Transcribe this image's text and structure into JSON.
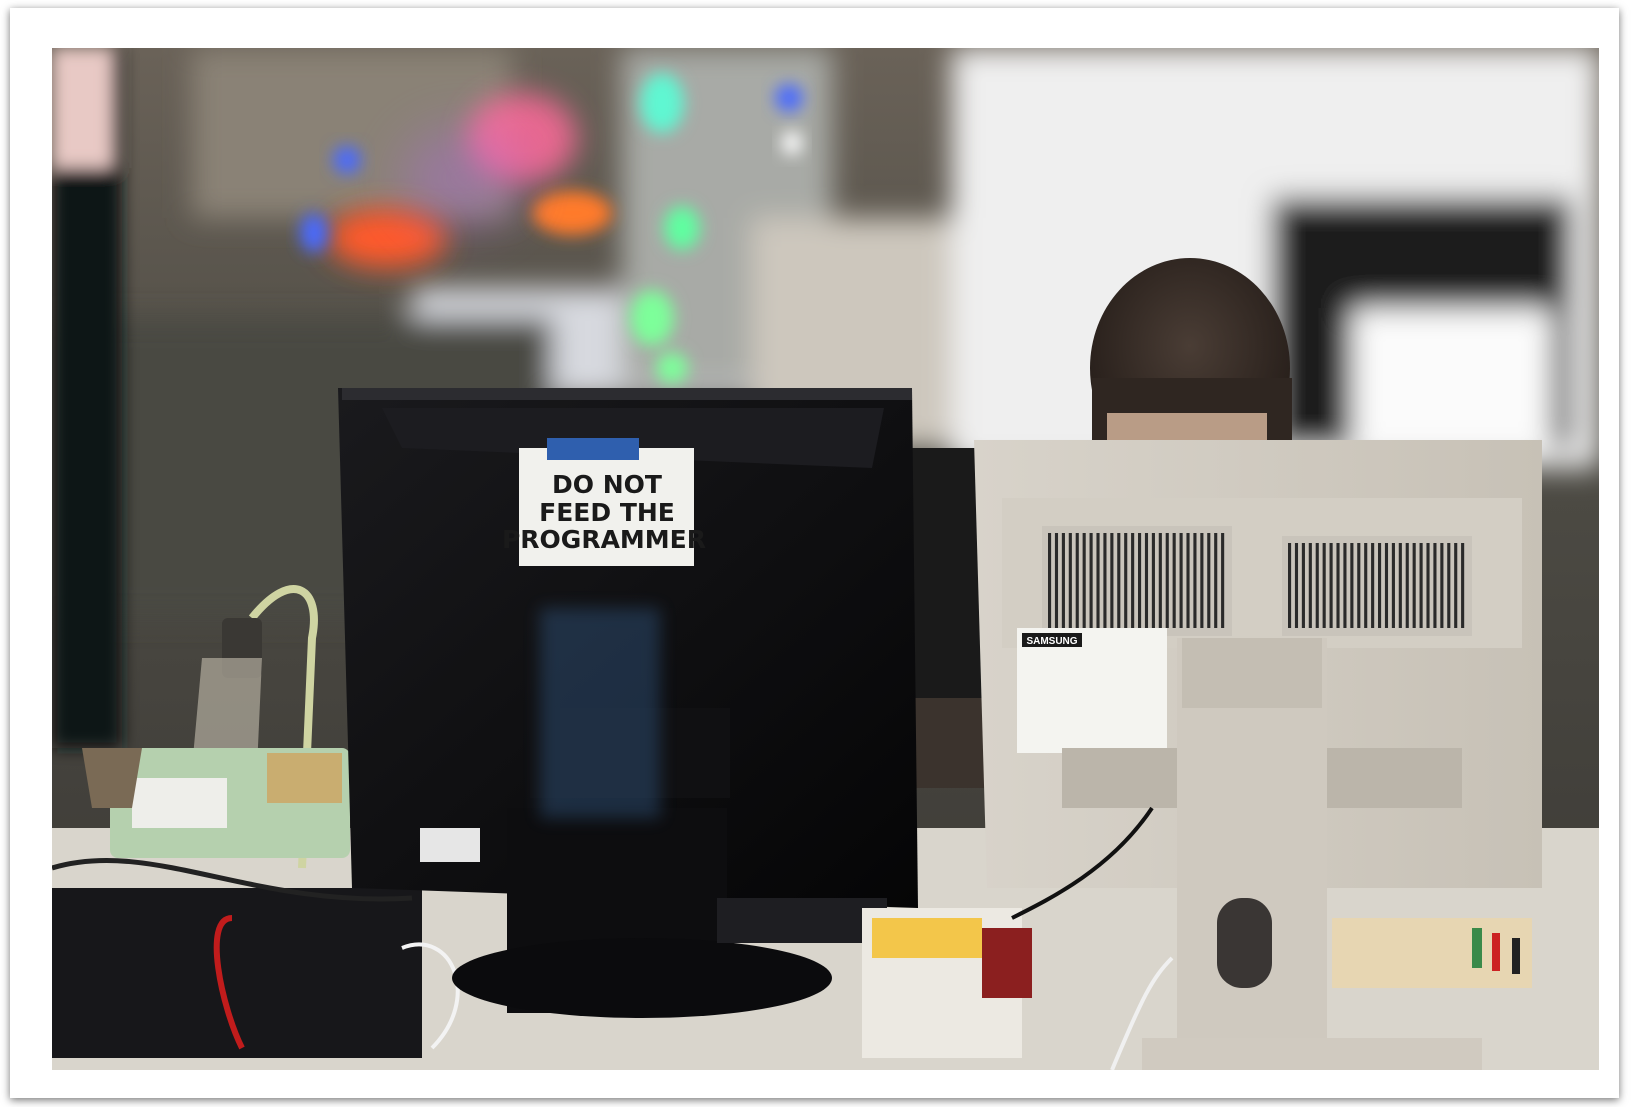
{
  "photo": {
    "sticky_note": {
      "lines": [
        "DO NOT",
        "FEED THE",
        "PROGRAMMER"
      ],
      "tape_color": "#2f5fae"
    },
    "logo_text": "SAMSUNG",
    "colors": {
      "light_pink": "#ff6a9a",
      "light_orange": "#ff5a2a",
      "light_green": "#7dff9a",
      "light_blue": "#4a6aff",
      "black_monitor": "#0e0e10",
      "beige_monitor": "#cfcac0"
    }
  }
}
